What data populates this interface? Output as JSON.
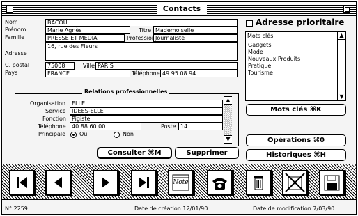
{
  "window": {
    "title": "Contacts"
  },
  "contact": {
    "nom_label": "Nom",
    "nom": "BACOU",
    "prenom_label": "Prénom",
    "prenom": "Marie Agnès",
    "titre_label": "Titre",
    "titre": "Mademoiselle",
    "famille_label": "Famille",
    "famille": "PRESSE ET MEDIA",
    "profession_label": "Profession",
    "profession": "Journaliste",
    "adresse_label": "Adresse",
    "adresse": "16, rue des Fleurs",
    "cpostal_label": "C. postal",
    "cpostal": "75008",
    "ville_label": "Ville",
    "ville": "PARIS",
    "pays_label": "Pays",
    "pays": "FRANCE",
    "telephone_label": "Téléphone",
    "telephone": "49 95 08 94"
  },
  "prioritaire": {
    "label": "Adresse prioritaire",
    "checked": false
  },
  "keywords": {
    "header": "Mots clés",
    "items": [
      "Gadgets",
      "Mode",
      "Nouveaux Produits",
      "Pratique",
      "Tourisme"
    ]
  },
  "relations": {
    "title": "Relations professionnelles",
    "organisation_label": "Organisation",
    "organisation": "ELLE",
    "service_label": "Service",
    "service": "IDEES-ELLE",
    "fonction_label": "Fonction",
    "fonction": "Pigiste",
    "telephone_label": "Téléphone",
    "telephone": "40 88 60 00",
    "poste_label": "Poste",
    "poste": "14",
    "principale_label": "Principale",
    "oui": "Oui",
    "non": "Non",
    "selected": "Oui"
  },
  "buttons": {
    "mots_cles": "Mots clés ⌘K",
    "consulter": "Consulter ⌘M",
    "supprimer": "Supprimer",
    "operations": "Opérations ⌘0",
    "historiques": "Historiques ⌘H"
  },
  "toolbar": {
    "note_label": "Note",
    "icons": [
      "first-record-icon",
      "previous-record-icon",
      "next-record-icon",
      "last-record-icon",
      "note-icon",
      "telephone-icon",
      "trash-icon",
      "delete-record-icon",
      "save-disk-icon"
    ]
  },
  "status": {
    "number": "N° 2259",
    "created": "Date de création  12/01/90",
    "modified": "Date de modification  7/03/90"
  }
}
